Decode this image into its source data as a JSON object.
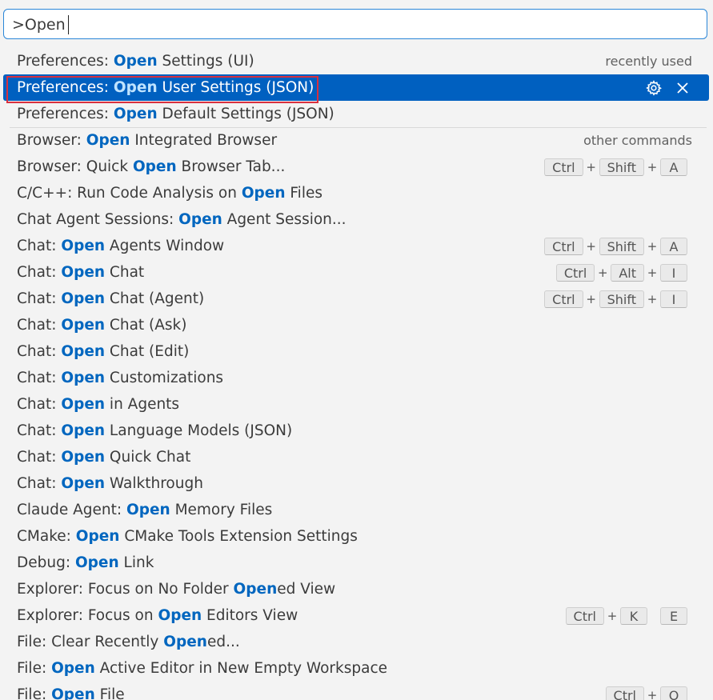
{
  "search": {
    "value": ">Open"
  },
  "items": [
    {
      "parts": [
        "Preferences: ",
        "Open",
        " Settings (UI)"
      ],
      "hl": [
        1
      ],
      "group": "recently used",
      "keys": []
    },
    {
      "parts": [
        "Preferences: ",
        "Open",
        " User Settings (JSON)"
      ],
      "hl": [
        1
      ],
      "selected": true,
      "actions": [
        "gear-icon",
        "close-icon"
      ],
      "keys": []
    },
    {
      "parts": [
        "Preferences: ",
        "Open",
        " Default Settings (JSON)"
      ],
      "hl": [
        1
      ],
      "keys": []
    },
    {
      "parts": [
        "Browser: ",
        "Open",
        " Integrated Browser"
      ],
      "hl": [
        1
      ],
      "group": "other commands",
      "separator": true,
      "keys": []
    },
    {
      "parts": [
        "Browser: Quick ",
        "Open",
        " Browser Tab..."
      ],
      "hl": [
        1
      ],
      "keys": [
        "Ctrl",
        "+",
        "Shift",
        "+",
        "A"
      ]
    },
    {
      "parts": [
        "C/C++: Run Code Analysis on ",
        "Open",
        " Files"
      ],
      "hl": [
        1
      ],
      "keys": []
    },
    {
      "parts": [
        "Chat Agent Sessions: ",
        "Open",
        " Agent Session..."
      ],
      "hl": [
        1
      ],
      "keys": []
    },
    {
      "parts": [
        "Chat: ",
        "Open",
        " Agents Window"
      ],
      "hl": [
        1
      ],
      "keys": [
        "Ctrl",
        "+",
        "Shift",
        "+",
        "A"
      ]
    },
    {
      "parts": [
        "Chat: ",
        "Open",
        " Chat"
      ],
      "hl": [
        1
      ],
      "keys": [
        "Ctrl",
        "+",
        "Alt",
        "+",
        "I"
      ]
    },
    {
      "parts": [
        "Chat: ",
        "Open",
        " Chat (Agent)"
      ],
      "hl": [
        1
      ],
      "keys": [
        "Ctrl",
        "+",
        "Shift",
        "+",
        "I"
      ]
    },
    {
      "parts": [
        "Chat: ",
        "Open",
        " Chat (Ask)"
      ],
      "hl": [
        1
      ],
      "keys": []
    },
    {
      "parts": [
        "Chat: ",
        "Open",
        " Chat (Edit)"
      ],
      "hl": [
        1
      ],
      "keys": []
    },
    {
      "parts": [
        "Chat: ",
        "Open",
        " Customizations"
      ],
      "hl": [
        1
      ],
      "keys": []
    },
    {
      "parts": [
        "Chat: ",
        "Open",
        " in Agents"
      ],
      "hl": [
        1
      ],
      "keys": []
    },
    {
      "parts": [
        "Chat: ",
        "Open",
        " Language Models (JSON)"
      ],
      "hl": [
        1
      ],
      "keys": []
    },
    {
      "parts": [
        "Chat: ",
        "Open",
        " Quick Chat"
      ],
      "hl": [
        1
      ],
      "keys": []
    },
    {
      "parts": [
        "Chat: ",
        "Open",
        " Walkthrough"
      ],
      "hl": [
        1
      ],
      "keys": []
    },
    {
      "parts": [
        "Claude Agent: ",
        "Open",
        " Memory Files"
      ],
      "hl": [
        1
      ],
      "keys": []
    },
    {
      "parts": [
        "CMake: ",
        "Open",
        " CMake Tools Extension Settings"
      ],
      "hl": [
        1
      ],
      "keys": []
    },
    {
      "parts": [
        "Debug: ",
        "Open",
        " Link"
      ],
      "hl": [
        1
      ],
      "keys": []
    },
    {
      "parts": [
        "Explorer: Focus on No Folder ",
        "Open",
        "ed View"
      ],
      "hl": [
        1
      ],
      "keys": []
    },
    {
      "parts": [
        "Explorer: Focus on ",
        "Open",
        " Editors View"
      ],
      "hl": [
        1
      ],
      "keys": [
        "Ctrl",
        "+",
        "K",
        " ",
        "E"
      ]
    },
    {
      "parts": [
        "File: Clear Recently ",
        "Open",
        "ed..."
      ],
      "hl": [
        1
      ],
      "keys": []
    },
    {
      "parts": [
        "File: ",
        "Open",
        " Active Editor in New Empty Workspace"
      ],
      "hl": [
        1
      ],
      "keys": []
    },
    {
      "parts": [
        "File: ",
        "Open",
        " File"
      ],
      "hl": [
        1
      ],
      "keys": [
        "Ctrl",
        "+",
        "O"
      ]
    }
  ],
  "colors": {
    "accent": "#0060c0",
    "highlight": "#0066bf",
    "annotation": "#d9303e"
  }
}
